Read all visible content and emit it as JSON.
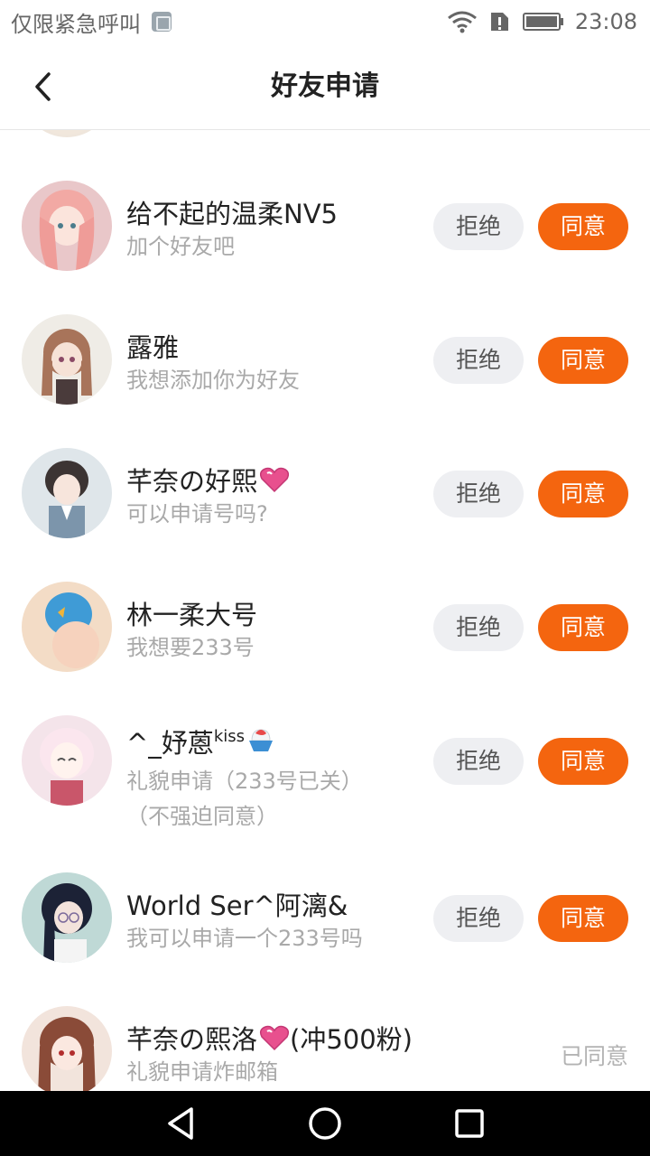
{
  "status": {
    "carrier_text": "仅限紧急呼叫",
    "time": "23:08",
    "icons": [
      "notification-icon",
      "wifi-icon",
      "sim-alert-icon",
      "battery-icon"
    ]
  },
  "header": {
    "title": "好友申请",
    "back_icon": "chevron-left-icon"
  },
  "buttons": {
    "reject": "拒绝",
    "accept": "同意"
  },
  "requests": [
    {
      "name": "给不起的温柔NV5",
      "message": "加个好友吧",
      "state": "pending"
    },
    {
      "name": "露雅",
      "message": "我想添加你为好友",
      "state": "pending"
    },
    {
      "name": "芊奈の好熙",
      "name_emoji": "heart-icon",
      "message": "可以申请号吗?",
      "state": "pending"
    },
    {
      "name": "林一柔大号",
      "message": "我想要233号",
      "state": "pending"
    },
    {
      "name": "^_妤蒽",
      "name_suffix": "kiss",
      "name_emoji": "shaved-ice-icon",
      "message": "礼貌申请（233号已关）",
      "message_line2": "（不强迫同意）",
      "state": "pending"
    },
    {
      "name": "World Ser^阿漓&",
      "message": "我可以申请一个233号吗",
      "state": "pending"
    },
    {
      "name": "芊奈の熙洛",
      "name_emoji": "heart-icon",
      "name_tail": "(冲500粉)",
      "message": "礼貌申请炸邮箱",
      "state": "accepted",
      "state_label": "已同意"
    }
  ],
  "colors": {
    "accent": "#f4650f",
    "reject_bg": "#eeeff2",
    "muted_text": "#a9a9a9"
  },
  "nav": {
    "icons": [
      "back-triangle-icon",
      "home-circle-icon",
      "recents-square-icon"
    ]
  }
}
